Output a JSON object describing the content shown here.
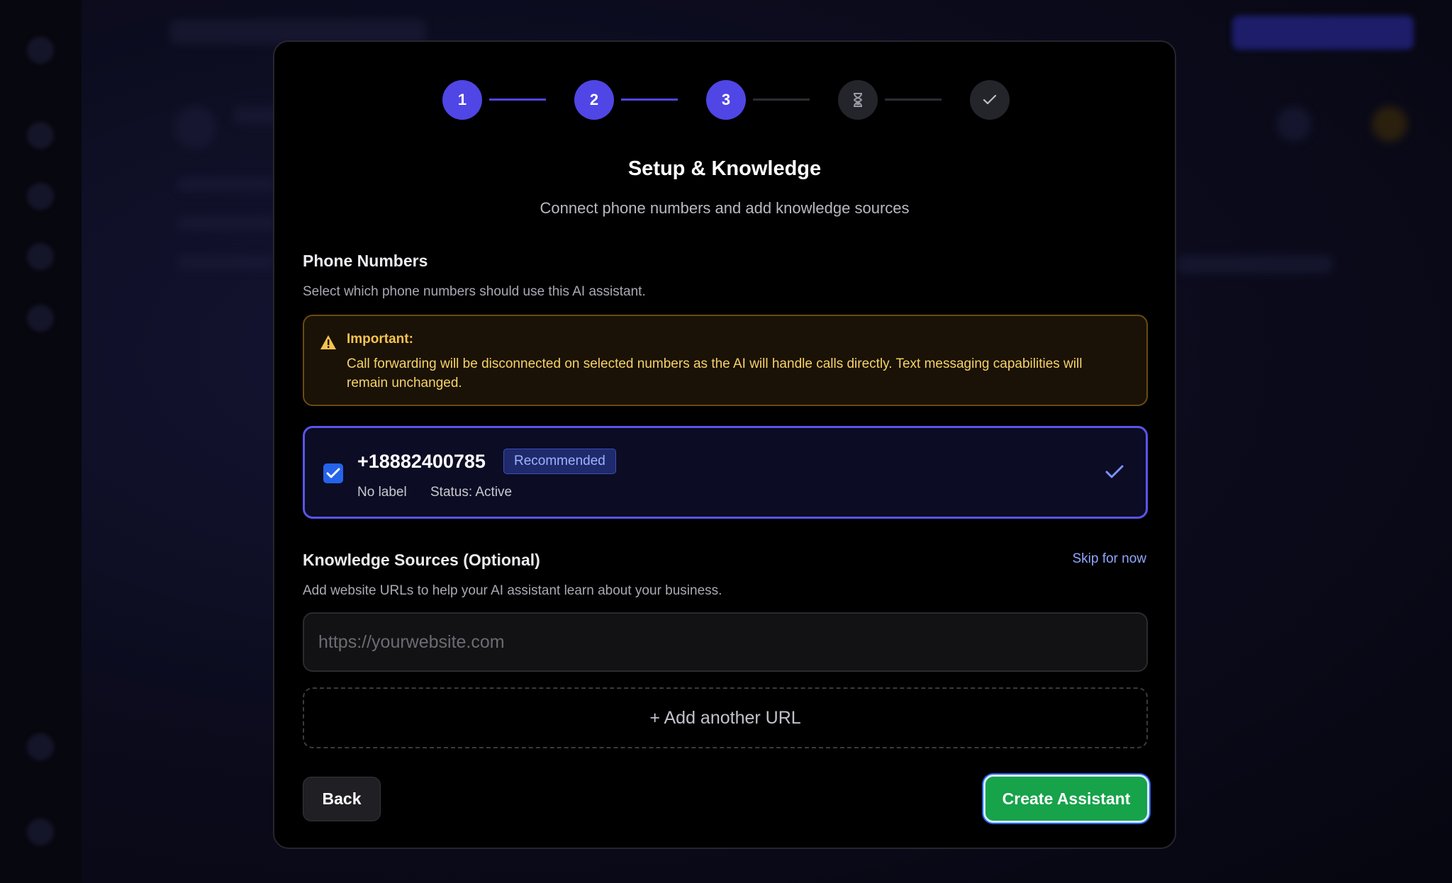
{
  "stepper": {
    "steps": [
      {
        "label": "1",
        "state": "active"
      },
      {
        "label": "2",
        "state": "active"
      },
      {
        "label": "3",
        "state": "active"
      },
      {
        "label": "",
        "icon": "hourglass-icon",
        "state": "pending"
      },
      {
        "label": "",
        "icon": "check-icon",
        "state": "pending"
      }
    ]
  },
  "header": {
    "title": "Setup & Knowledge",
    "subtitle": "Connect phone numbers and add knowledge sources"
  },
  "phone_numbers": {
    "title": "Phone Numbers",
    "description": "Select which phone numbers should use this AI assistant.",
    "warning": {
      "title": "Important:",
      "text": "Call forwarding will be disconnected on selected numbers as the AI will handle calls directly. Text messaging capabilities will remain unchanged."
    },
    "items": [
      {
        "number": "+18882400785",
        "badge": "Recommended",
        "label": "No label",
        "status": "Status: Active",
        "checked": true
      }
    ]
  },
  "knowledge": {
    "title": "Knowledge Sources (Optional)",
    "skip_label": "Skip for now",
    "description": "Add website URLs to help your AI assistant learn about your business.",
    "url_placeholder": "https://yourwebsite.com",
    "add_url_label": "+ Add another URL"
  },
  "footer": {
    "back_label": "Back",
    "create_label": "Create Assistant"
  },
  "colors": {
    "accent": "#4f46e5",
    "success": "#16a34a",
    "warning": "#f6c350"
  }
}
